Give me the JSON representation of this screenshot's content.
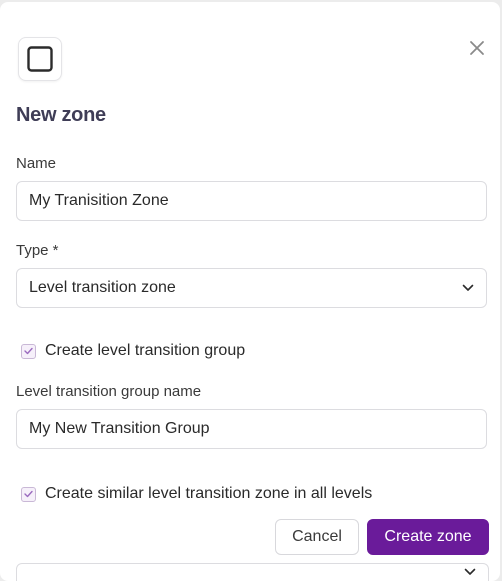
{
  "modal": {
    "title": "New zone",
    "header_icon": "square-outline-icon",
    "close_icon": "close-icon"
  },
  "form": {
    "name": {
      "label": "Name",
      "value": "My Tranisition Zone"
    },
    "type": {
      "label": "Type *",
      "selected": "Level transition zone"
    },
    "create_group": {
      "label": "Create level transition group",
      "checked": true
    },
    "group_name": {
      "label": "Level transition group name",
      "value": "My New Transition Group"
    },
    "similar_zones": {
      "label": "Create similar level transition zone in all levels",
      "checked": true
    }
  },
  "actions": {
    "cancel_label": "Cancel",
    "create_label": "Create zone"
  },
  "colors": {
    "primary": "#6a1b9a",
    "title": "#3f3d56",
    "checkbox_check": "#9b6bbf"
  }
}
